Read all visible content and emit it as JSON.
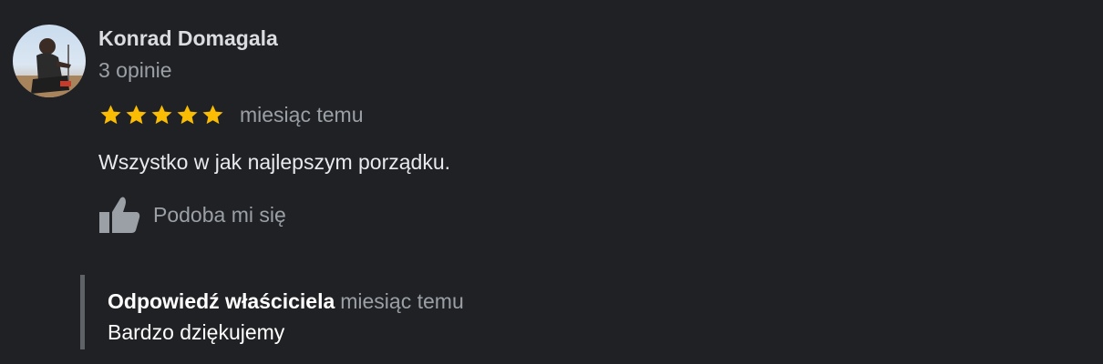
{
  "review": {
    "author": {
      "name": "Konrad Domagala",
      "reviews_count": "3 opinie"
    },
    "rating": {
      "stars": 5,
      "max": 5,
      "color": "#fbbc04"
    },
    "date": "miesiąc temu",
    "text": "Wszystko w jak najlepszym porządku.",
    "like_label": "Podoba mi się",
    "like_icon": "thumbs-up-icon"
  },
  "owner_reply": {
    "title": "Odpowiedź właściciela",
    "date": "miesiąc temu",
    "text": "Bardzo dziękujemy"
  },
  "colors": {
    "background": "#202124",
    "muted_text": "#9aa0a6",
    "reply_bar": "#5f6368"
  }
}
